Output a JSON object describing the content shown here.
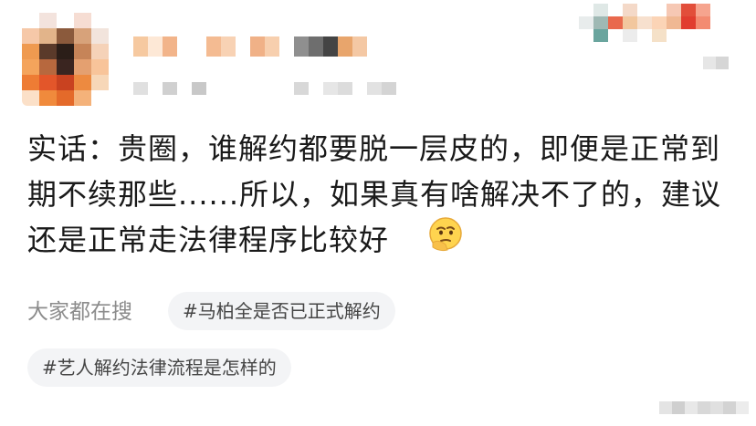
{
  "post": {
    "text": "实话：贵圈，谁解约都要脱一层皮的，即便是正常到期不续那些......所以，如果真有啥解决不了的，建议还是正常走法律程序比较好",
    "emoji": "thinking-face-emoji"
  },
  "search": {
    "label": "大家都在搜",
    "chips": [
      "#马柏全是否已正式解约",
      "#艺人解约法律流程是怎样的"
    ]
  },
  "colors": {
    "text": "#1a1a1a",
    "muted": "#8c8c8c",
    "chip_bg": "#f3f4f6"
  }
}
